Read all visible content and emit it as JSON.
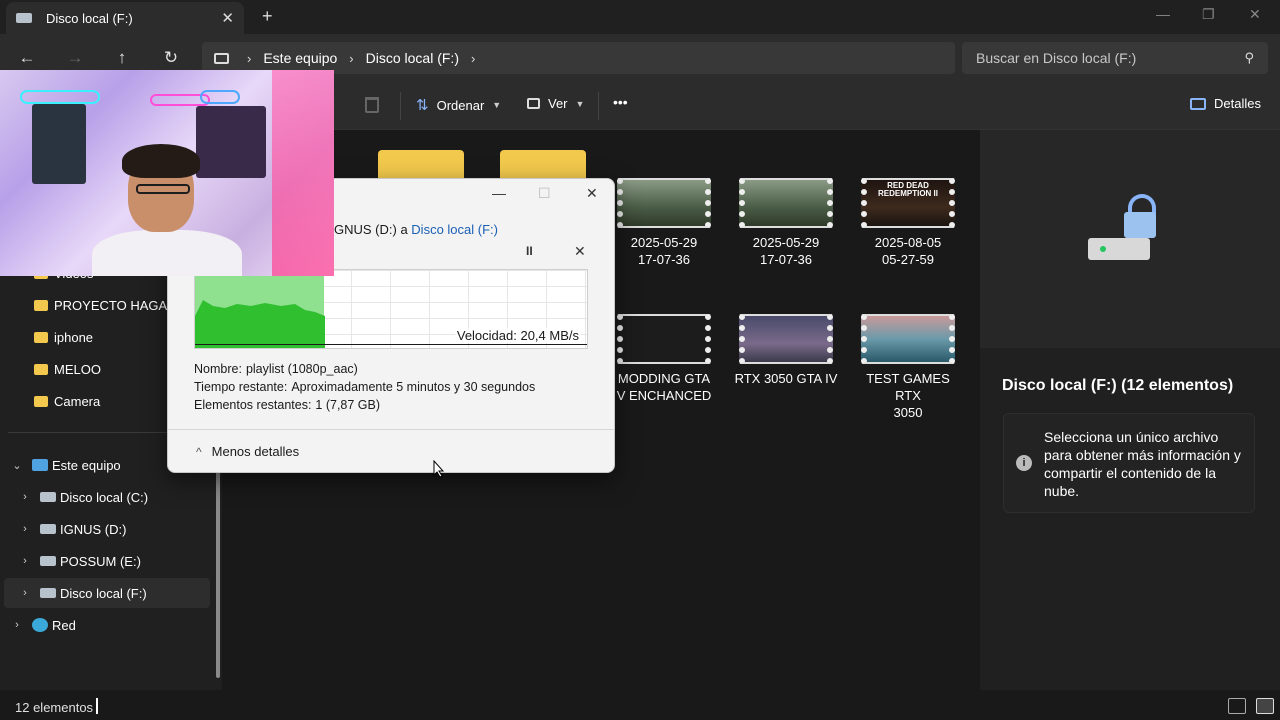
{
  "window": {
    "tab_title": "Disco local (F:)",
    "tab_close": "✕",
    "new_tab": "+",
    "minimize": "—",
    "maximize": "❐",
    "close": "✕"
  },
  "nav": {
    "back": "←",
    "forward": "→",
    "up": "↑",
    "refresh": "↻",
    "breadcrumbs": [
      "Este equipo",
      "Disco local (F:)"
    ],
    "search_placeholder": "Buscar en Disco local (F:)"
  },
  "commands": {
    "sort_label": "Ordenar",
    "view_label": "Ver",
    "more_label": "•••",
    "details_label": "Detalles"
  },
  "sidebar": {
    "items": [
      {
        "label": "Videos"
      },
      {
        "label": "PROYECTO HAGALO E"
      },
      {
        "label": "iphone"
      },
      {
        "label": "MELOO"
      },
      {
        "label": "Camera"
      }
    ],
    "this_pc": "Este equipo",
    "drives": [
      {
        "label": "Disco local (C:)"
      },
      {
        "label": "IGNUS (D:)"
      },
      {
        "label": "POSSUM (E:)"
      },
      {
        "label": "Disco local (F:)"
      }
    ],
    "network": "Red"
  },
  "files": {
    "row1": [
      {
        "line1": "2025-05-29",
        "line2": "17-07-36"
      },
      {
        "line1": "2025-05-29",
        "line2": "17-07-36"
      },
      {
        "line1": "2025-08-05",
        "line2": "05-27-59",
        "thumb_text": "RED DEAD REDEMPTION II"
      }
    ],
    "row2": [
      {
        "line1": "MODDING GTA",
        "line2": "V ENCHANCED"
      },
      {
        "line1": "RTX 3050 GTA IV",
        "line2": ""
      },
      {
        "line1": "TEST GAMES RTX",
        "line2": "3050"
      }
    ]
  },
  "details_pane": {
    "title": "Disco local (F:) (12 elementos)",
    "info_icon": "i",
    "info_text": "Selecciona un único archivo para obtener más información y compartir el contenido de la nube."
  },
  "status": {
    "count": "12 elementos"
  },
  "copy_dialog": {
    "route_prefix": "GNUS (D:) a ",
    "route_dest": "Disco local (F:)",
    "minimize": "—",
    "maximize": "☐",
    "close": "✕",
    "pause": "II",
    "cancel": "✕",
    "speed_text": "Velocidad: 20,4 MB/s",
    "progress": 0.33,
    "name_label": "Nombre:",
    "name_value": "playlist (1080p_aac)",
    "time_label": "Tiempo restante:",
    "time_value": "Aproximadamente 5 minutos y 30 segundos",
    "items_label": "Elementos restantes:",
    "items_value": "1 (7,87 GB)",
    "less_details": "Menos detalles",
    "chevron": "^"
  }
}
